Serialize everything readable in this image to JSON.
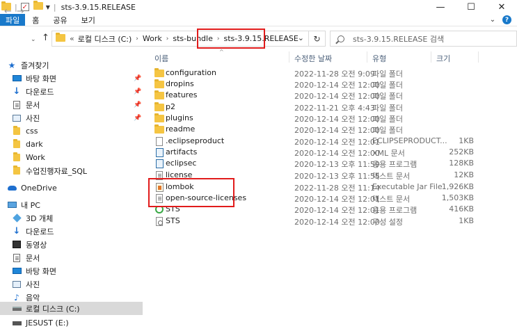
{
  "window": {
    "title": "sts-3.9.15.RELEASE",
    "minimize": "—",
    "maximize": "☐",
    "close": "✕"
  },
  "ribbon": {
    "tabs": [
      "파일",
      "홈",
      "공유",
      "보기"
    ],
    "active_color": "#1979ca"
  },
  "address": {
    "prefix": "«",
    "crumbs": [
      "로컬 디스크 (C:)",
      "Work",
      "sts-bundle",
      "sts-3.9.15.RELEASE"
    ],
    "dropdown": "⌄",
    "refresh": "↻"
  },
  "search": {
    "placeholder": "sts-3.9.15.RELEASE 검색"
  },
  "sidebar": {
    "items": [
      {
        "label": "즐겨찾기",
        "icon": "star-icon"
      },
      {
        "label": "바탕 화면",
        "icon": "desktop-icon",
        "pinned": true
      },
      {
        "label": "다운로드",
        "icon": "download-icon",
        "pinned": true
      },
      {
        "label": "문서",
        "icon": "document-icon",
        "pinned": true
      },
      {
        "label": "사진",
        "icon": "pictures-icon",
        "pinned": true
      },
      {
        "label": "css",
        "icon": "folder-icon"
      },
      {
        "label": "dark",
        "icon": "folder-icon"
      },
      {
        "label": "Work",
        "icon": "folder-icon"
      },
      {
        "label": "수업진행자료_SQL",
        "icon": "folder-icon"
      },
      {
        "label": "OneDrive",
        "icon": "cloud-icon"
      },
      {
        "label": "내 PC",
        "icon": "pc-icon"
      },
      {
        "label": "3D 개체",
        "icon": "3d-objects-icon"
      },
      {
        "label": "다운로드",
        "icon": "download-icon"
      },
      {
        "label": "동영상",
        "icon": "video-icon"
      },
      {
        "label": "문서",
        "icon": "document-icon"
      },
      {
        "label": "바탕 화면",
        "icon": "desktop-icon"
      },
      {
        "label": "사진",
        "icon": "pictures-icon"
      },
      {
        "label": "음악",
        "icon": "music-icon"
      },
      {
        "label": "로컬 디스크 (C:)",
        "icon": "drive-icon",
        "selected": true
      },
      {
        "label": "JESUST (E:)",
        "icon": "usb-drive-icon"
      }
    ]
  },
  "columns": {
    "name": "이름",
    "date": "수정한 날짜",
    "type": "유형",
    "size": "크기"
  },
  "files": [
    {
      "name": "configuration",
      "date": "2022-11-28 오전 9:09",
      "type": "파일 폴더",
      "size": "",
      "kind": "folder"
    },
    {
      "name": "dropins",
      "date": "2020-12-14 오전 12:00",
      "type": "파일 폴더",
      "size": "",
      "kind": "folder"
    },
    {
      "name": "features",
      "date": "2020-12-14 오전 12:00",
      "type": "파일 폴더",
      "size": "",
      "kind": "folder"
    },
    {
      "name": "p2",
      "date": "2022-11-21 오후 4:43",
      "type": "파일 폴더",
      "size": "",
      "kind": "folder"
    },
    {
      "name": "plugins",
      "date": "2020-12-14 오전 12:00",
      "type": "파일 폴더",
      "size": "",
      "kind": "folder"
    },
    {
      "name": "readme",
      "date": "2020-12-14 오전 12:00",
      "type": "파일 폴더",
      "size": "",
      "kind": "folder"
    },
    {
      "name": ".eclipseproduct",
      "date": "2020-12-14 오전 12:01",
      "type": "ECLIPSEPRODUCT...",
      "size": "1KB",
      "kind": "file"
    },
    {
      "name": "artifacts",
      "date": "2020-12-14 오전 12:00",
      "type": "XML 문서",
      "size": "252KB",
      "kind": "artifact"
    },
    {
      "name": "eclipsec",
      "date": "2020-12-13 오후 11:59",
      "type": "응용 프로그램",
      "size": "128KB",
      "kind": "artifact"
    },
    {
      "name": "license",
      "date": "2020-12-13 오후 11:55",
      "type": "텍스트 문서",
      "size": "12KB",
      "kind": "txt"
    },
    {
      "name": "lombok",
      "date": "2022-11-28 오전 11:14",
      "type": "Executable Jar File",
      "size": "1,926KB",
      "kind": "jar"
    },
    {
      "name": "open-source-licenses",
      "date": "2020-12-14 오전 12:01",
      "type": "텍스트 문서",
      "size": "1,503KB",
      "kind": "txt"
    },
    {
      "name": "STS",
      "date": "2020-12-14 오전 12:01",
      "type": "응용 프로그램",
      "size": "416KB",
      "kind": "sts"
    },
    {
      "name": "STS",
      "date": "2020-12-14 오전 12:00",
      "type": "구성 설정",
      "size": "1KB",
      "kind": "cfg"
    }
  ],
  "colors": {
    "highlight_box": "#e11b1b",
    "selection": "#d9d9d9",
    "folder": "#f5c543"
  }
}
